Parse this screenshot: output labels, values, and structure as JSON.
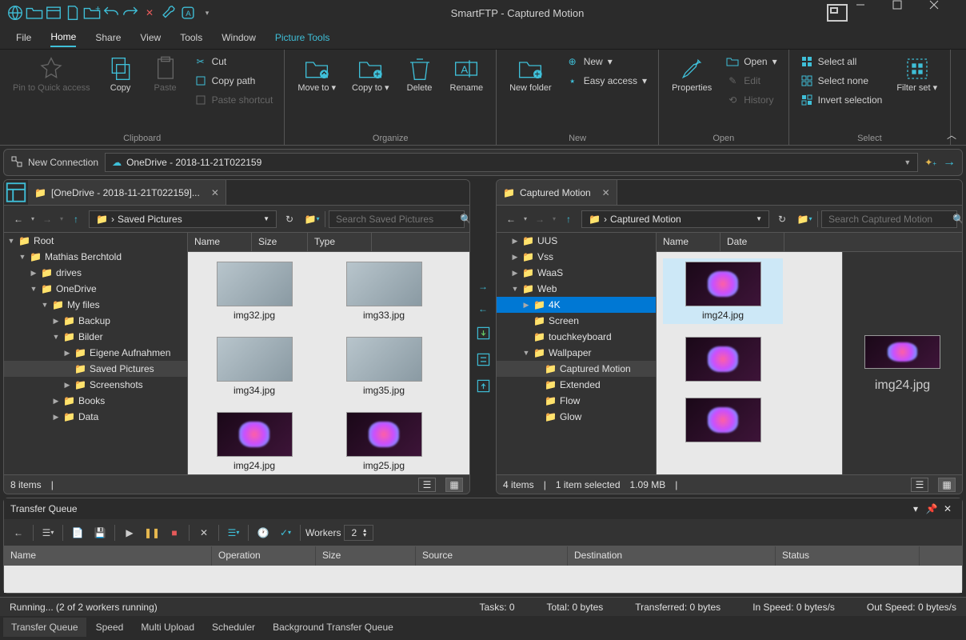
{
  "title": "SmartFTP - Captured Motion",
  "menu": [
    "File",
    "Home",
    "Share",
    "View",
    "Tools",
    "Window",
    "Picture Tools"
  ],
  "menu_active": 1,
  "menu_teal": 6,
  "ribbon": {
    "clipboard": {
      "label": "Clipboard",
      "pin": "Pin to Quick access",
      "copy": "Copy",
      "paste": "Paste",
      "cut": "Cut",
      "copypath": "Copy path",
      "pasteshort": "Paste shortcut"
    },
    "organize": {
      "label": "Organize",
      "move": "Move to",
      "copy": "Copy to",
      "delete": "Delete",
      "rename": "Rename"
    },
    "new": {
      "label": "New",
      "newfolder": "New folder",
      "new": "New",
      "easy": "Easy access"
    },
    "open": {
      "label": "Open",
      "properties": "Properties",
      "open": "Open",
      "edit": "Edit",
      "history": "History"
    },
    "select": {
      "label": "Select",
      "all": "Select all",
      "none": "Select none",
      "invert": "Invert selection",
      "filter": "Filter set"
    }
  },
  "connection": {
    "new": "New Connection",
    "addr": "OneDrive - 2018-11-21T022159"
  },
  "left": {
    "tab": "[OneDrive - 2018-11-21T022159]...",
    "crumb": "Saved Pictures",
    "search_ph": "Search Saved Pictures",
    "tree": [
      {
        "l": "Root",
        "d": 0,
        "e": true
      },
      {
        "l": "Mathias Berchtold",
        "d": 1,
        "e": true
      },
      {
        "l": "drives",
        "d": 2,
        "c": true
      },
      {
        "l": "OneDrive",
        "d": 2,
        "e": true
      },
      {
        "l": "My files",
        "d": 3,
        "e": true
      },
      {
        "l": "Backup",
        "d": 4,
        "c": true
      },
      {
        "l": "Bilder",
        "d": 4,
        "e": true
      },
      {
        "l": "Eigene Aufnahmen",
        "d": 5,
        "c": true
      },
      {
        "l": "Saved Pictures",
        "d": 5,
        "sel": true
      },
      {
        "l": "Screenshots",
        "d": 5,
        "c": true
      },
      {
        "l": "Books",
        "d": 4,
        "c": true
      },
      {
        "l": "Data",
        "d": 4,
        "c": true
      }
    ],
    "cols": [
      "Name",
      "Size",
      "Type"
    ],
    "files": [
      {
        "n": "img32.jpg",
        "t": "light"
      },
      {
        "n": "img33.jpg",
        "t": "light"
      },
      {
        "n": "img34.jpg",
        "t": "light"
      },
      {
        "n": "img35.jpg",
        "t": "light"
      },
      {
        "n": "img24.jpg",
        "t": "dark"
      },
      {
        "n": "img25.jpg",
        "t": "dark"
      }
    ],
    "status": "8 items"
  },
  "right": {
    "tab": "Captured Motion",
    "crumb": "Captured Motion",
    "search_ph": "Search Captured Motion",
    "tree": [
      {
        "l": "UUS",
        "d": 1,
        "c": true
      },
      {
        "l": "Vss",
        "d": 1,
        "c": true
      },
      {
        "l": "WaaS",
        "d": 1,
        "c": true
      },
      {
        "l": "Web",
        "d": 1,
        "e": true
      },
      {
        "l": "4K",
        "d": 2,
        "c": true,
        "hl": true
      },
      {
        "l": "Screen",
        "d": 2
      },
      {
        "l": "touchkeyboard",
        "d": 2
      },
      {
        "l": "Wallpaper",
        "d": 2,
        "e": true
      },
      {
        "l": "Captured Motion",
        "d": 3,
        "sel": true
      },
      {
        "l": "Extended",
        "d": 3
      },
      {
        "l": "Flow",
        "d": 3
      },
      {
        "l": "Glow",
        "d": 3
      }
    ],
    "cols": [
      "Name",
      "Date"
    ],
    "files": [
      {
        "n": "img24.jpg",
        "t": "dark",
        "sel": true
      },
      {
        "n": "",
        "t": "dark"
      },
      {
        "n": "",
        "t": "dark"
      }
    ],
    "preview": "img24.jpg",
    "status_items": "4 items",
    "status_sel": "1 item selected",
    "status_size": "1.09 MB"
  },
  "queue": {
    "title": "Transfer Queue",
    "workers_label": "Workers",
    "workers": "2",
    "cols": [
      "Name",
      "Operation",
      "Size",
      "Source",
      "Destination",
      "Status"
    ]
  },
  "botstatus": {
    "running": "Running... (2 of 2 workers running)",
    "tasks": "Tasks: 0",
    "total": "Total: 0 bytes",
    "transferred": "Transferred: 0 bytes",
    "inspeed": "In Speed: 0 bytes/s",
    "outspeed": "Out Speed: 0 bytes/s"
  },
  "bottabs": [
    "Transfer Queue",
    "Speed",
    "Multi Upload",
    "Scheduler",
    "Background Transfer Queue"
  ]
}
